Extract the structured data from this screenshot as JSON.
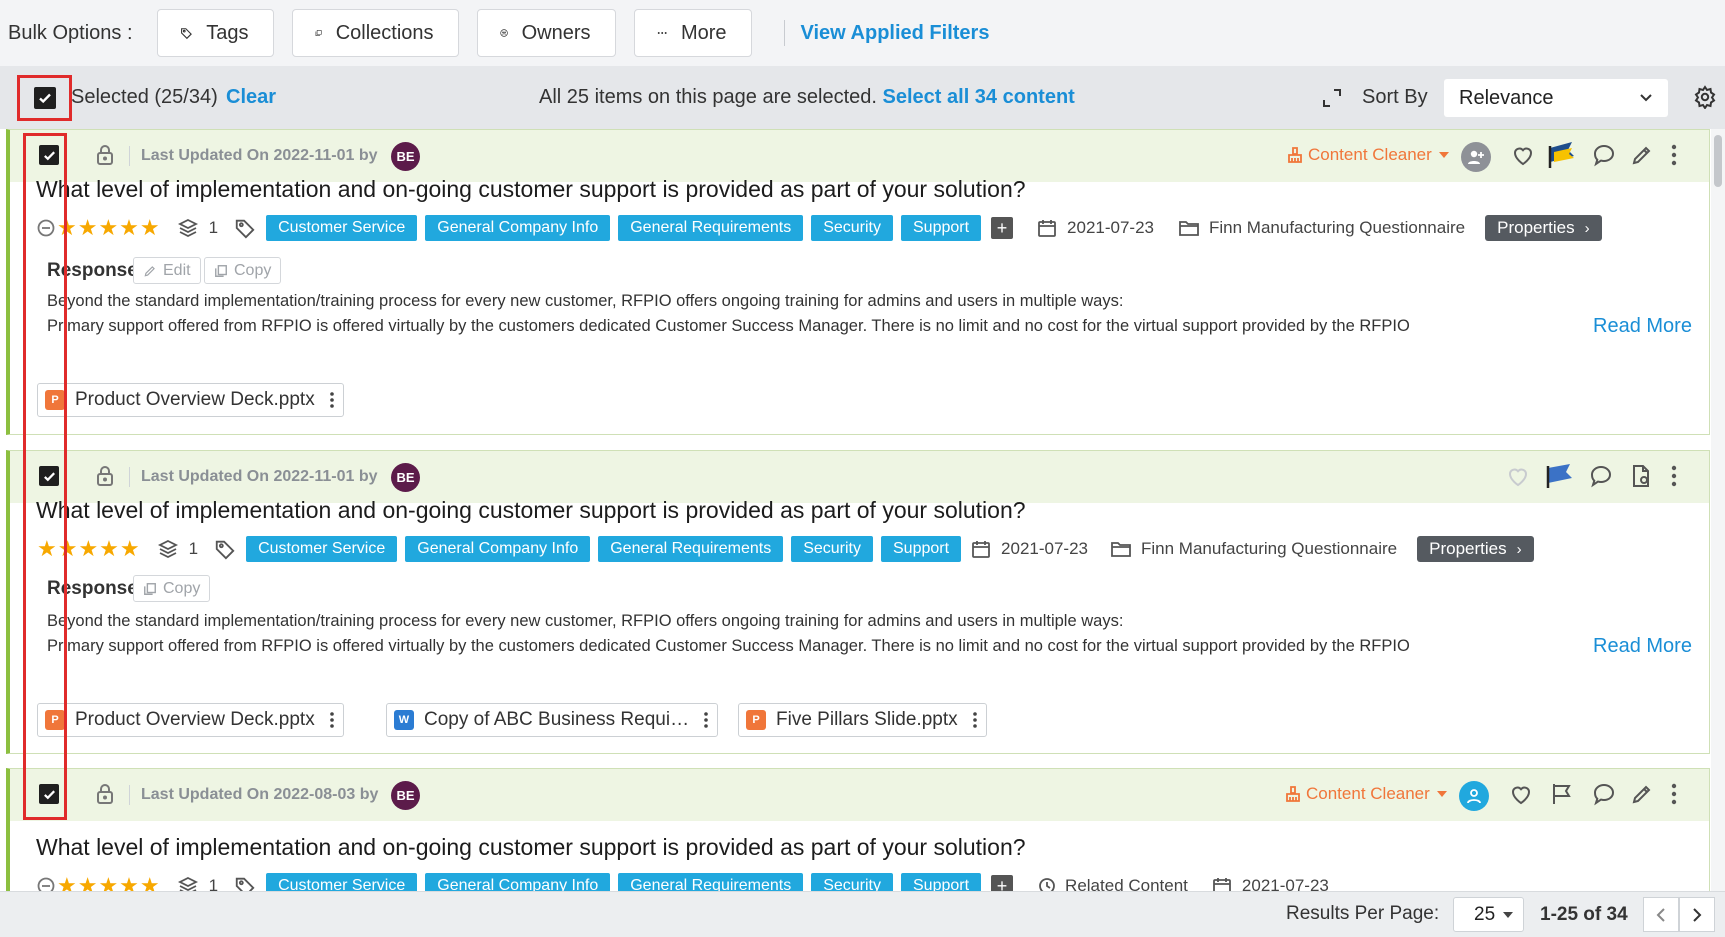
{
  "bulk": {
    "label": "Bulk Options :",
    "buttons": [
      {
        "label": "Tags",
        "icon": "tag-icon"
      },
      {
        "label": "Collections",
        "icon": "collections-icon"
      },
      {
        "label": "Owners",
        "icon": "owners-icon"
      },
      {
        "label": "More",
        "icon": "more-dots-icon"
      }
    ],
    "view_filters": "View Applied Filters"
  },
  "selection": {
    "selected_text": "Selected (25/34)",
    "clear": "Clear",
    "message": "All 25 items on this page are selected.",
    "select_all": "Select all 34 content",
    "sort_label": "Sort By",
    "sort_value": "Relevance"
  },
  "colors": {
    "accent_blue": "#1a8ed6",
    "tag_blue": "#21a8de",
    "content_cleaner": "#f0763a",
    "card_header": "#eef5e3",
    "highlight_red": "#e02b2b"
  },
  "cards": [
    {
      "updated": "Last Updated On 2022-11-01 by",
      "avatar": "BE",
      "content_cleaner": "Content Cleaner",
      "title": "What level of implementation and on-going customer support is provided as part of your solution?",
      "rating": 5,
      "version_count": "1",
      "tags": [
        "Customer Service",
        "General Company Info",
        "General Requirements",
        "Security",
        "Support"
      ],
      "plus": "+",
      "date": "2021-07-23",
      "project": "Finn Manufacturing Questionnaire",
      "properties": "Properties",
      "response_label": "Response",
      "edit": "Edit",
      "copy": "Copy",
      "response_lines": [
        "Beyond the standard implementation/training process for every new customer, RFPIO offers ongoing training for admins and users in multiple ways:",
        "Primary support offered from RFPIO is offered virtually by the customers dedicated Customer Success Manager. There is no limit and no cost for the virtual support provided by the RFPIO"
      ],
      "read_more": "Read More",
      "attachments": [
        "Product Overview Deck.pptx"
      ]
    },
    {
      "updated": "Last Updated On 2022-11-01 by",
      "avatar": "BE",
      "title": "What level of implementation and on-going customer support is provided as part of your solution?",
      "rating": 5,
      "version_count": "1",
      "tags": [
        "Customer Service",
        "General Company Info",
        "General Requirements",
        "Security",
        "Support"
      ],
      "date": "2021-07-23",
      "project": "Finn Manufacturing Questionnaire",
      "properties": "Properties",
      "response_label": "Response",
      "copy": "Copy",
      "response_lines": [
        "Beyond the standard implementation/training process for every new customer, RFPIO offers ongoing training for admins and users in multiple ways:",
        "Primary support offered from RFPIO is offered virtually by the customers dedicated Customer Success Manager. There is no limit and no cost for the virtual support provided by the RFPIO"
      ],
      "read_more": "Read More",
      "attachments": [
        "Product Overview Deck.pptx",
        "Copy of ABC Business Requi…",
        "Five Pillars Slide.pptx"
      ]
    },
    {
      "updated": "Last Updated On 2022-08-03 by",
      "avatar": "BE",
      "content_cleaner": "Content Cleaner",
      "title": "What level of implementation and on-going customer support is provided as part of your solution?",
      "rating": 5,
      "version_count": "1",
      "tags": [
        "Customer Service",
        "General Company Info",
        "General Requirements",
        "Security",
        "Support"
      ],
      "plus": "+",
      "related": "Related Content",
      "date": "2021-07-23"
    }
  ],
  "footer": {
    "results_label": "Results Per Page:",
    "per_page": "25",
    "range": "1-25 of 34"
  }
}
